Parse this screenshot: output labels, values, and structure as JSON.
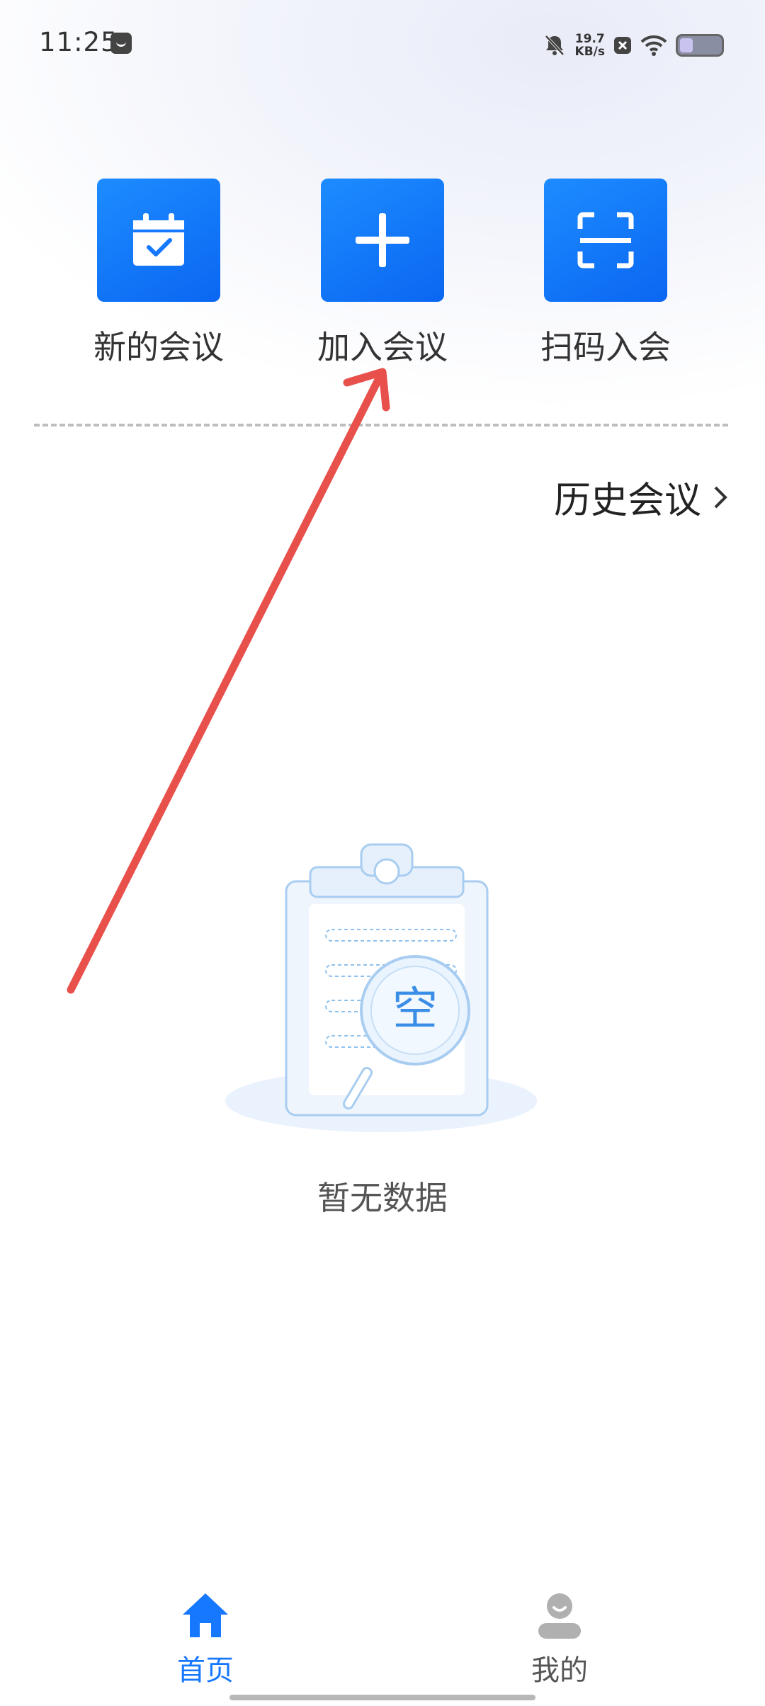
{
  "status_bar": {
    "time": "11:25",
    "net_speed_value": "19.7",
    "net_speed_unit": "KB/s",
    "icons": [
      "app-notification-icon",
      "mute-bell-icon",
      "close-box-icon",
      "wifi-icon",
      "battery-icon"
    ]
  },
  "actions": [
    {
      "label": "新的会议",
      "icon": "calendar-check-icon"
    },
    {
      "label": "加入会议",
      "icon": "plus-icon"
    },
    {
      "label": "扫码入会",
      "icon": "scan-icon"
    }
  ],
  "history": {
    "label": "历史会议",
    "icon": "chevron-right-icon"
  },
  "empty_state": {
    "badge": "空",
    "message": "暂无数据"
  },
  "bottom_nav": [
    {
      "label": "首页",
      "icon": "home-icon",
      "active": true
    },
    {
      "label": "我的",
      "icon": "user-icon",
      "active": false
    }
  ],
  "colors": {
    "accent": "#1677ff",
    "tile_gradient_start": "#1d8cff",
    "tile_gradient_end": "#0a66f2",
    "annotation_arrow": "#e8504c",
    "inactive_nav": "#b0b0b0"
  }
}
